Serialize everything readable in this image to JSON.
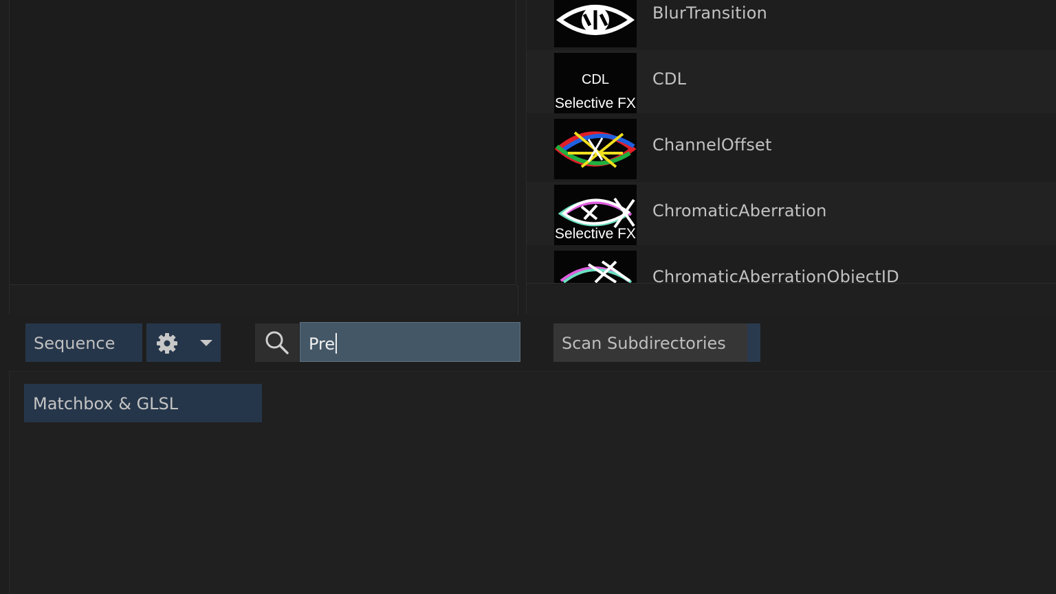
{
  "effects_list": {
    "items": [
      {
        "label": "BlurTransition",
        "thumb": "fish-eye-logo-icon"
      },
      {
        "label": "CDL",
        "thumb": "cdl-selective-fx-icon",
        "thumb_top": "CDL",
        "thumb_bottom": "Selective FX"
      },
      {
        "label": "ChannelOffset",
        "thumb": "rgb-fish-logo-icon"
      },
      {
        "label": "ChromaticAberration",
        "thumb": "chromatic-fish-selective-fx-icon",
        "thumb_bottom": "Selective FX"
      },
      {
        "label": "ChromaticAberrationObjectID",
        "thumb": "chromatic-fish-partial-icon"
      }
    ]
  },
  "toolbar": {
    "sequence_label": "Sequence",
    "settings_icon": "gear-icon",
    "dropdown_icon": "chevron-down-icon",
    "search_icon": "search-icon",
    "search_value": "Pre",
    "scan_label": "Scan Subdirectories"
  },
  "bins": {
    "tab_label": "Matchbox & GLSL"
  },
  "colors": {
    "background": "#1e1e1e",
    "accent_blue": "#26364a",
    "search_field": "#445767"
  }
}
